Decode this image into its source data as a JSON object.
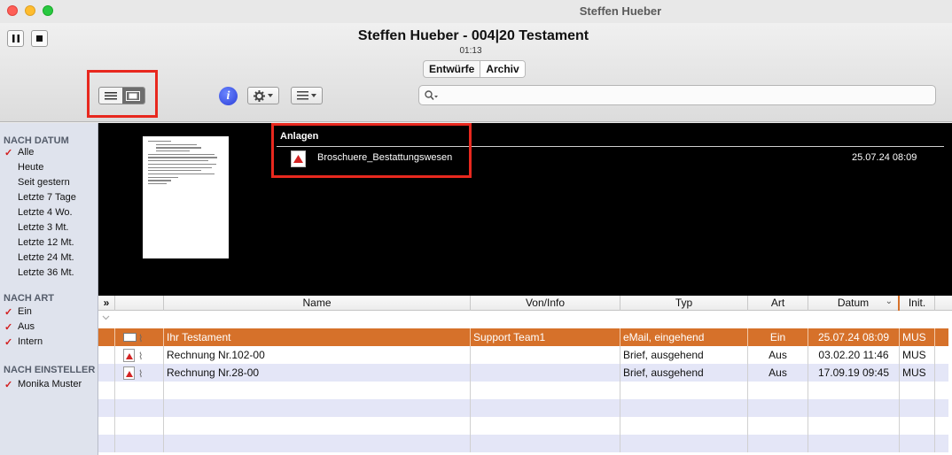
{
  "window": {
    "title": "Steffen Hueber"
  },
  "header": {
    "doc_title": "Steffen Hueber - 004|20 Testament",
    "time": "01:13",
    "pause_icon": "pause-icon",
    "stop_icon": "stop-icon",
    "tabs": [
      {
        "label": "Entwürfe",
        "active": false
      },
      {
        "label": "Archiv",
        "active": true
      }
    ]
  },
  "toolbar": {
    "view_toggle": {
      "options": [
        "list-view-icon",
        "preview-view-icon"
      ],
      "selected": "preview-view-icon"
    },
    "info_icon": "i",
    "gear_icon": "gear-icon",
    "list_icon": "list-icon",
    "search_placeholder": ""
  },
  "sidebar": {
    "sections": [
      {
        "title": "NACH DATUM",
        "items": [
          {
            "label": "Alle",
            "checked": true
          },
          {
            "label": "Heute",
            "checked": false
          },
          {
            "label": "Seit gestern",
            "checked": false
          },
          {
            "label": "Letzte 7 Tage",
            "checked": false
          },
          {
            "label": "Letzte 4 Wo.",
            "checked": false
          },
          {
            "label": "Letzte 3 Mt.",
            "checked": false
          },
          {
            "label": "Letzte 12 Mt.",
            "checked": false
          },
          {
            "label": "Letzte 24 Mt.",
            "checked": false
          },
          {
            "label": "Letzte 36 Mt.",
            "checked": false
          }
        ]
      },
      {
        "title": "NACH ART",
        "items": [
          {
            "label": "Ein",
            "checked": true
          },
          {
            "label": "Aus",
            "checked": true
          },
          {
            "label": "Intern",
            "checked": true
          }
        ]
      },
      {
        "title": "NACH EINSTELLER",
        "items": [
          {
            "label": "Monika Muster",
            "checked": true
          }
        ]
      }
    ]
  },
  "preview": {
    "attachments_title": "Anlagen",
    "attachments": [
      {
        "icon": "pdf-icon",
        "name": "Broschuere_Bestattungswesen",
        "date": "25.07.24 08:09"
      }
    ]
  },
  "table": {
    "expand_symbol": "»",
    "columns": [
      "Name",
      "Von/Info",
      "Typ",
      "Art",
      "Datum",
      "Init."
    ],
    "sort_indicator": "⌄",
    "rows": [
      {
        "icon": "mail-icon",
        "name": "Ihr Testament",
        "von": "Support Team1",
        "typ": "eMail, eingehend",
        "art": "Ein",
        "datum": "25.07.24 08:09",
        "init": "MUS",
        "selected": true
      },
      {
        "icon": "pdf-icon",
        "name": "Rechnung Nr.102-00",
        "von": "",
        "typ": "Brief, ausgehend",
        "art": "Aus",
        "datum": "03.02.20 11:46",
        "init": "MUS",
        "selected": false
      },
      {
        "icon": "pdf-icon",
        "name": "Rechnung Nr.28-00",
        "von": "",
        "typ": "Brief, ausgehend",
        "art": "Aus",
        "datum": "17.09.19 09:45",
        "init": "MUS",
        "selected": false
      }
    ]
  },
  "colors": {
    "selection": "#d6712a",
    "alt_row": "#e4e6f7",
    "sidebar": "#dfe3ed",
    "highlight_box": "#e8281e",
    "check": "#d21d1d"
  }
}
